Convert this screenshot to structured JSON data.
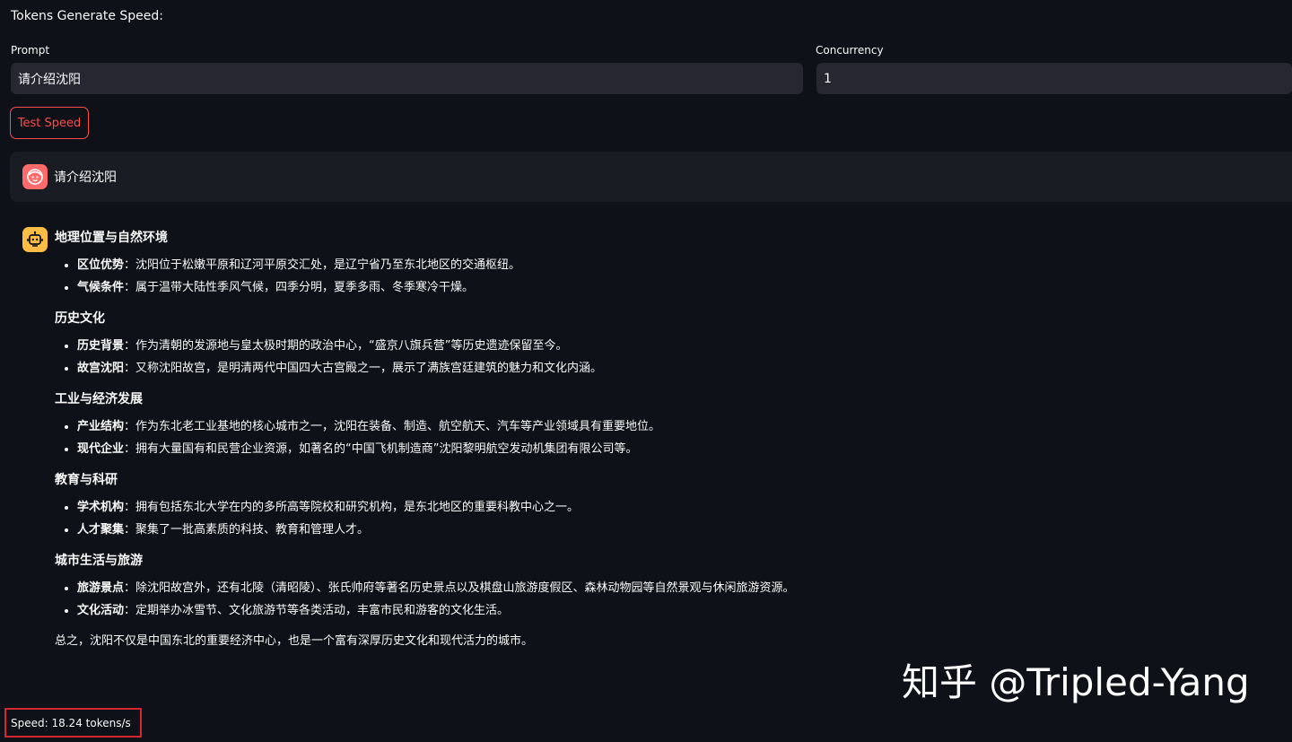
{
  "app": {
    "title": "Tokens Generate Speed:"
  },
  "form": {
    "prompt_label": "Prompt",
    "prompt_value": "请介绍沈阳",
    "concurrency_label": "Concurrency",
    "concurrency_value": "1",
    "test_button_label": "Test Speed"
  },
  "chat": {
    "user_message": "请介绍沈阳",
    "sections": [
      {
        "heading": "地理位置与自然环境",
        "items": [
          {
            "term": "区位优势",
            "text": "：沈阳位于松嫩平原和辽河平原交汇处，是辽宁省乃至东北地区的交通枢纽。"
          },
          {
            "term": "气候条件",
            "text": "：属于温带大陆性季风气候，四季分明，夏季多雨、冬季寒冷干燥。"
          }
        ]
      },
      {
        "heading": "历史文化",
        "items": [
          {
            "term": "历史背景",
            "text": "：作为清朝的发源地与皇太极时期的政治中心，“盛京八旗兵营”等历史遗迹保留至今。"
          },
          {
            "term": "故宫沈阳",
            "text": "：又称沈阳故宫，是明清两代中国四大古宫殿之一，展示了满族宫廷建筑的魅力和文化内涵。"
          }
        ]
      },
      {
        "heading": "工业与经济发展",
        "items": [
          {
            "term": "产业结构",
            "text": "：作为东北老工业基地的核心城市之一，沈阳在装备、制造、航空航天、汽车等产业领域具有重要地位。"
          },
          {
            "term": "现代企业",
            "text": "：拥有大量国有和民营企业资源，如著名的“中国飞机制造商”沈阳黎明航空发动机集团有限公司等。"
          }
        ]
      },
      {
        "heading": "教育与科研",
        "items": [
          {
            "term": "学术机构",
            "text": "：拥有包括东北大学在内的多所高等院校和研究机构，是东北地区的重要科教中心之一。"
          },
          {
            "term": "人才聚集",
            "text": "：聚集了一批高素质的科技、教育和管理人才。"
          }
        ]
      },
      {
        "heading": "城市生活与旅游",
        "items": [
          {
            "term": "旅游景点",
            "text": "：除沈阳故宫外，还有北陵（清昭陵）、张氏帅府等著名历史景点以及棋盘山旅游度假区、森林动物园等自然景观与休闲旅游资源。"
          },
          {
            "term": "文化活动",
            "text": "：定期举办冰雪节、文化旅游节等各类活动，丰富市民和游客的文化生活。"
          }
        ]
      }
    ],
    "conclusion": "总之，沈阳不仅是中国东北的重要经济中心，也是一个富有深厚历史文化和现代活力的城市。"
  },
  "speed": {
    "text": "Speed: 18.24 tokens/s"
  },
  "watermark": {
    "text": "知乎 @Tripled-Yang"
  },
  "colors": {
    "background": "#0e1117",
    "input_bg": "#262730",
    "accent": "#ff4b4b",
    "user_avatar": "#ff6b6b",
    "bot_avatar": "#ffbd45",
    "highlight_box": "#d8262f"
  },
  "icons": {
    "user_avatar": "user-face-icon",
    "bot_avatar": "robot-icon"
  }
}
